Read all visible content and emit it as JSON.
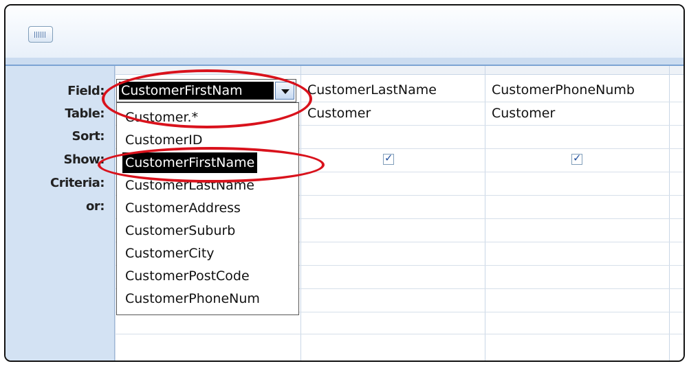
{
  "grid": {
    "row_labels": [
      "Field:",
      "Table:",
      "Sort:",
      "Show:",
      "Criteria:",
      "or:"
    ],
    "columns": [
      {
        "field": "CustomerFirstName",
        "table": "Customer.*"
      },
      {
        "field": "CustomerLastName",
        "table": "Customer",
        "show": true
      },
      {
        "field": "CustomerPhoneNumb",
        "table": "Customer",
        "show": true
      }
    ]
  },
  "field_combo": {
    "selected": "CustomerFirstNam"
  },
  "dropdown": {
    "items": [
      "Customer.*",
      "CustomerID",
      "CustomerFirstName",
      "CustomerLastName",
      "CustomerAddress",
      "CustomerSuburb",
      "CustomerCity",
      "CustomerPostCode",
      "CustomerPhoneNum"
    ],
    "highlighted_index": 2
  },
  "icons": {
    "toolbar": "table-grid-icon",
    "dropdown_arrow": "chevron-down-icon",
    "checkbox": "check-icon"
  },
  "colors": {
    "highlight_oval": "#d9121c",
    "label_panel": "#d3e2f3"
  }
}
